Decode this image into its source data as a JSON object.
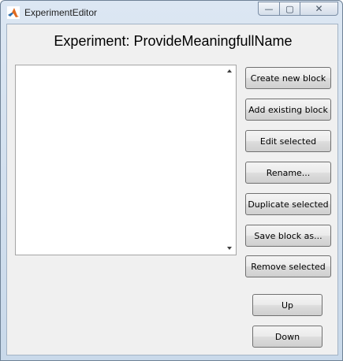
{
  "window": {
    "title": "ExperimentEditor",
    "minimize_glyph": "—",
    "maximize_glyph": "▢",
    "close_glyph": "✕"
  },
  "heading": "Experiment: ProvideMeaningfullName",
  "block_list": {
    "items": []
  },
  "buttons": {
    "create_new_block": "Create new block",
    "add_existing_block": "Add existing block",
    "edit_selected": "Edit selected",
    "rename": "Rename...",
    "duplicate_selected": "Duplicate selected",
    "save_block_as": "Save block as...",
    "remove_selected": "Remove selected",
    "up": "Up",
    "down": "Down"
  },
  "colors": {
    "client_background": "#f0f0f0",
    "titlebar": "#dce7f3",
    "matlab_icon_orange": "#e06a1f",
    "matlab_icon_blue": "#2a6fb0"
  }
}
